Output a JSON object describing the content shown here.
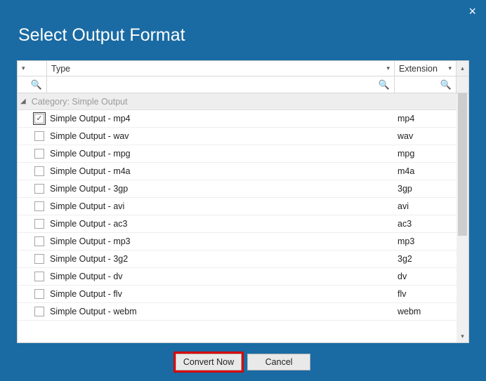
{
  "window": {
    "title": "Select Output Format"
  },
  "columns": {
    "type": "Type",
    "ext": "Extension"
  },
  "group": {
    "label": "Category:  Simple Output"
  },
  "rows": [
    {
      "type": "Simple Output - mp4",
      "ext": "mp4",
      "checked": true
    },
    {
      "type": "Simple Output - wav",
      "ext": "wav",
      "checked": false
    },
    {
      "type": "Simple Output - mpg",
      "ext": "mpg",
      "checked": false
    },
    {
      "type": "Simple Output - m4a",
      "ext": "m4a",
      "checked": false
    },
    {
      "type": "Simple Output - 3gp",
      "ext": "3gp",
      "checked": false
    },
    {
      "type": "Simple Output - avi",
      "ext": "avi",
      "checked": false
    },
    {
      "type": "Simple Output - ac3",
      "ext": "ac3",
      "checked": false
    },
    {
      "type": "Simple Output - mp3",
      "ext": "mp3",
      "checked": false
    },
    {
      "type": "Simple Output - 3g2",
      "ext": "3g2",
      "checked": false
    },
    {
      "type": "Simple Output - dv",
      "ext": "dv",
      "checked": false
    },
    {
      "type": "Simple Output - flv",
      "ext": "flv",
      "checked": false
    },
    {
      "type": "Simple Output - webm",
      "ext": "webm",
      "checked": false
    }
  ],
  "footer": {
    "convert": "Convert Now",
    "cancel": "Cancel"
  }
}
